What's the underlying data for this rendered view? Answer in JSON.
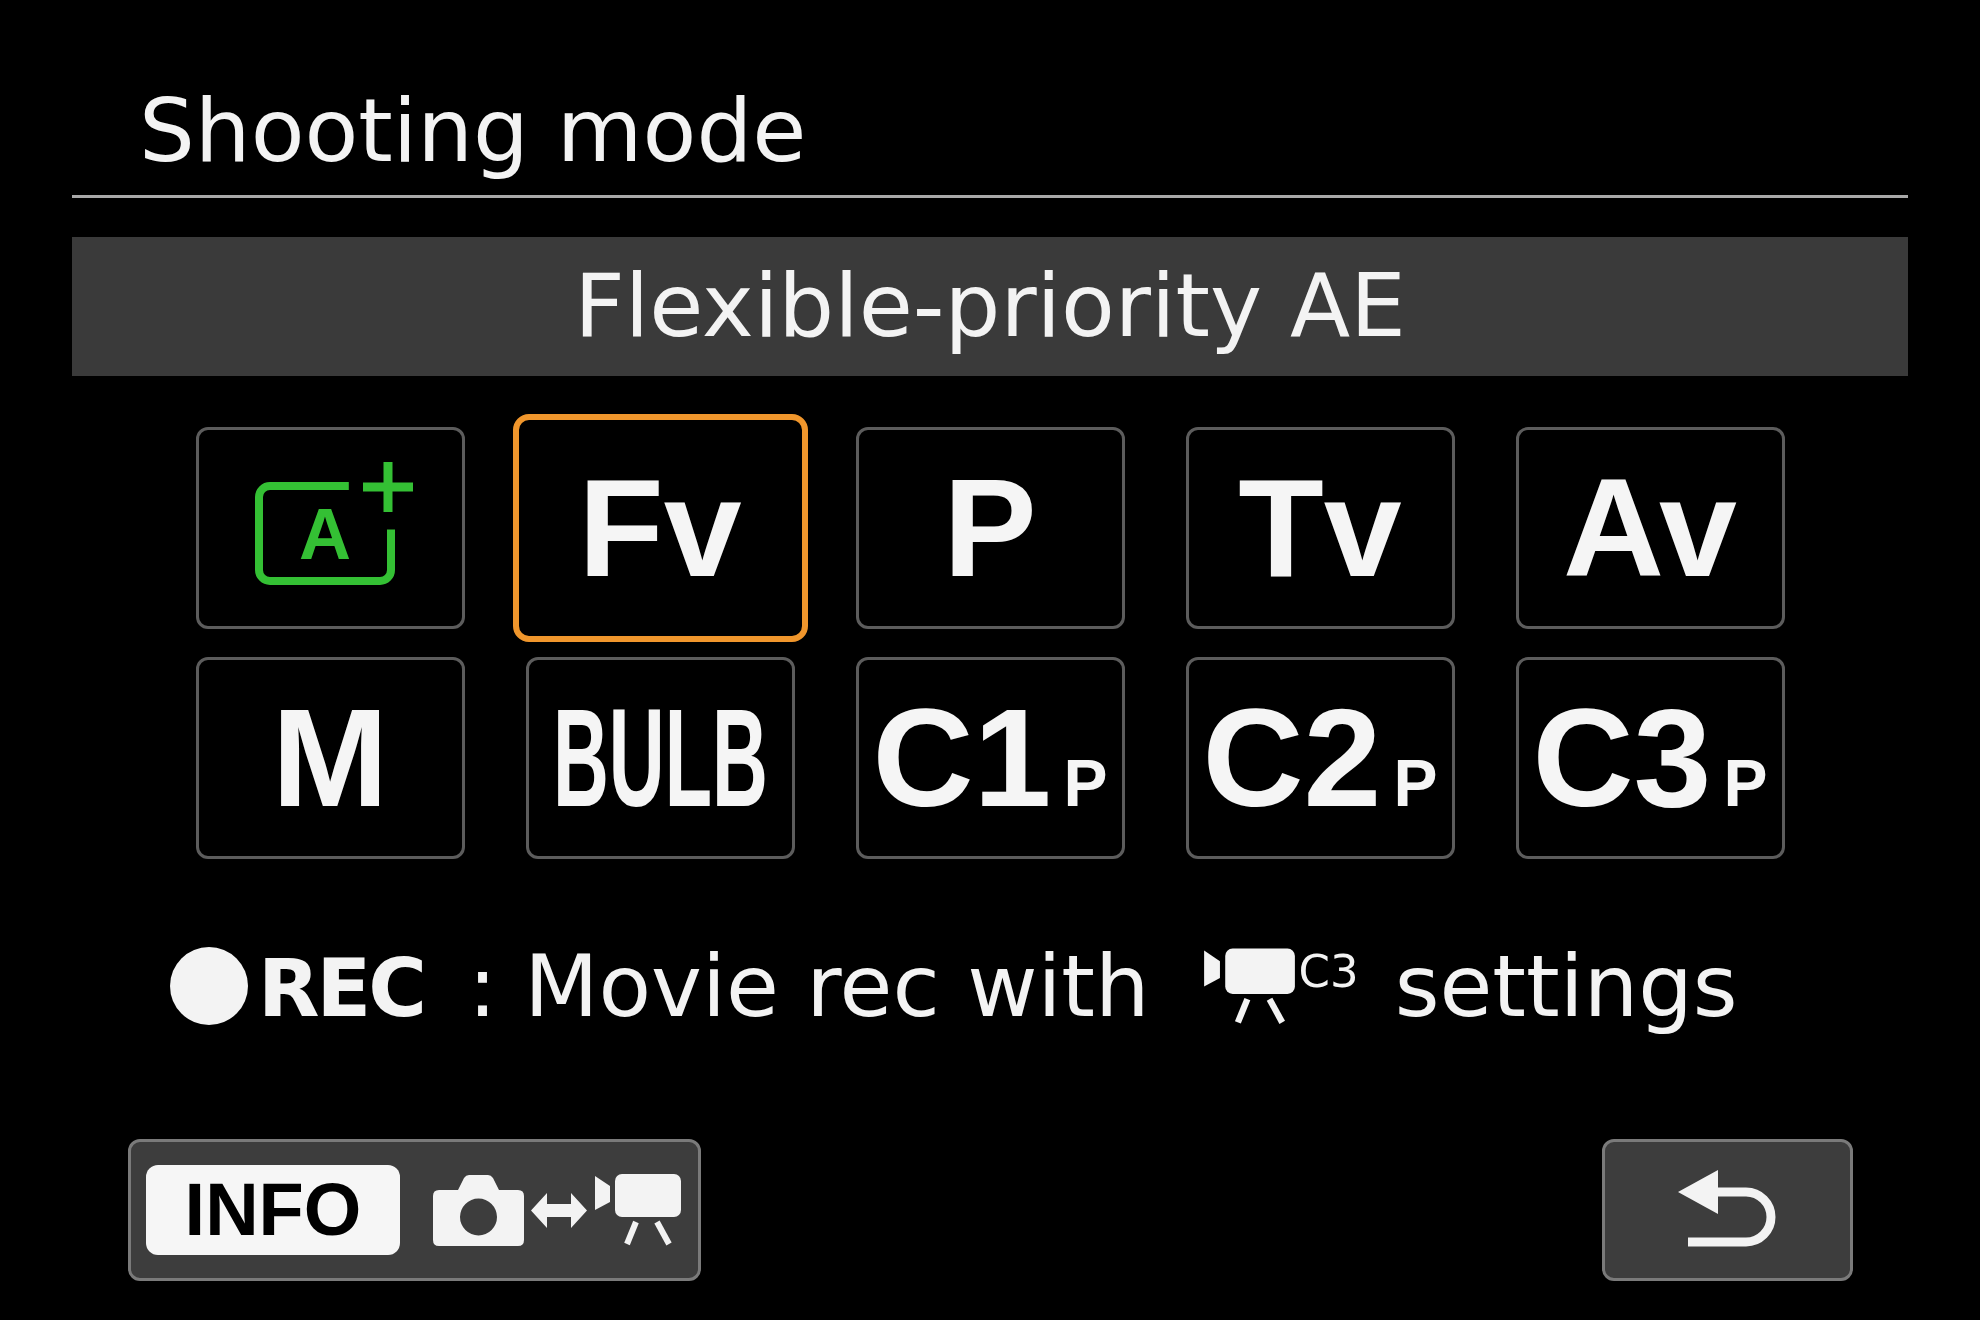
{
  "title": "Shooting mode",
  "current_mode": "Flexible-priority AE",
  "modes": [
    {
      "kind": "scene",
      "label": "A",
      "selected": false
    },
    {
      "kind": "text",
      "label": "Fv",
      "selected": true
    },
    {
      "kind": "text",
      "label": "P",
      "selected": false
    },
    {
      "kind": "text",
      "label": "Tv",
      "selected": false
    },
    {
      "kind": "text",
      "label": "Av",
      "selected": false
    },
    {
      "kind": "text",
      "label": "M",
      "selected": false
    },
    {
      "kind": "text",
      "label": "BULB",
      "selected": false
    },
    {
      "kind": "custom",
      "label": "C1",
      "sub": "P",
      "selected": false
    },
    {
      "kind": "custom",
      "label": "C2",
      "sub": "P",
      "selected": false
    },
    {
      "kind": "custom",
      "label": "C3",
      "sub": "P",
      "selected": false
    }
  ],
  "rec_note": {
    "label": "REC",
    "text": ": Movie rec with",
    "mode_mark": "C3",
    "text_end": "settings"
  },
  "footer": {
    "info_key": "INFO"
  }
}
